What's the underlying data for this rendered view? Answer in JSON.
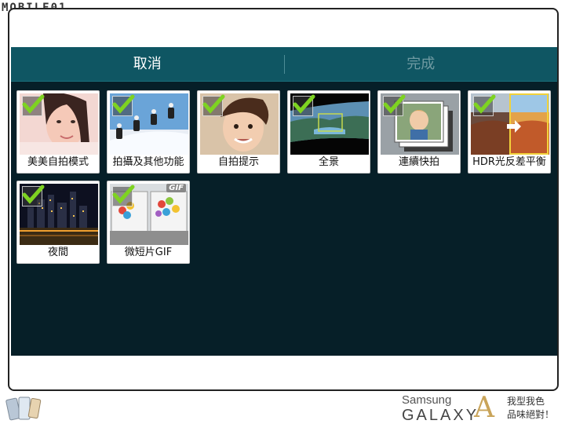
{
  "watermark": "MOBILE01",
  "header": {
    "cancel_label": "取消",
    "done_label": "完成"
  },
  "modes": [
    {
      "label": "美美自拍模式",
      "checked": true,
      "icon": "beauty-face-thumbnail"
    },
    {
      "label": "拍攝及其他功能",
      "checked": true,
      "icon": "snowboard-sequence-thumbnail"
    },
    {
      "label": "自拍提示",
      "checked": true,
      "icon": "selfie-boy-thumbnail"
    },
    {
      "label": "全景",
      "checked": true,
      "icon": "panorama-thumbnail"
    },
    {
      "label": "連續快拍",
      "checked": true,
      "icon": "burst-shot-thumbnail"
    },
    {
      "label": "HDR光反差平衡",
      "checked": true,
      "icon": "hdr-canyon-thumbnail"
    },
    {
      "label": "夜間",
      "checked": true,
      "icon": "night-city-thumbnail"
    },
    {
      "label": "微短片GIF",
      "checked": true,
      "icon": "gif-balloons-thumbnail",
      "badge": "GIF"
    }
  ],
  "footer": {
    "brand_line1": "Samsung",
    "brand_line2": "GALAXY",
    "brand_letter": "A",
    "slogan_line1": "我型我色",
    "slogan_line2": "品味絕對！"
  },
  "colors": {
    "topbar": "#0f5663",
    "screen_bg": "#061f28",
    "check_green": "#7ed321"
  }
}
